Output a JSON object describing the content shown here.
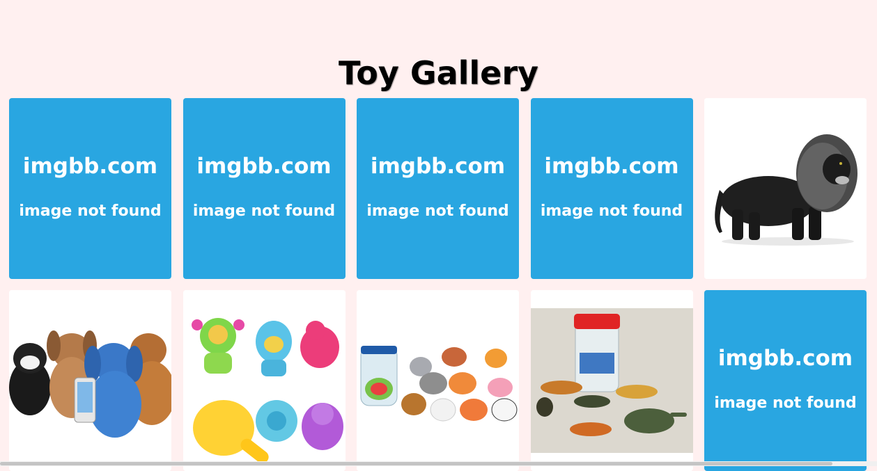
{
  "page": {
    "title": "Toy Gallery"
  },
  "placeholder": {
    "domain": "imgbb.com",
    "message": "image not found",
    "color": "#29a6e1"
  },
  "gallery": {
    "items": [
      {
        "kind": "placeholder"
      },
      {
        "kind": "placeholder"
      },
      {
        "kind": "placeholder"
      },
      {
        "kind": "placeholder"
      },
      {
        "kind": "image",
        "subject": "black lion figurine"
      },
      {
        "kind": "image",
        "subject": "plush toys group"
      },
      {
        "kind": "image",
        "subject": "baby bath toys"
      },
      {
        "kind": "image",
        "subject": "farm animal figures jar"
      },
      {
        "kind": "image",
        "subject": "wild animal figures jar"
      },
      {
        "kind": "placeholder"
      }
    ]
  }
}
